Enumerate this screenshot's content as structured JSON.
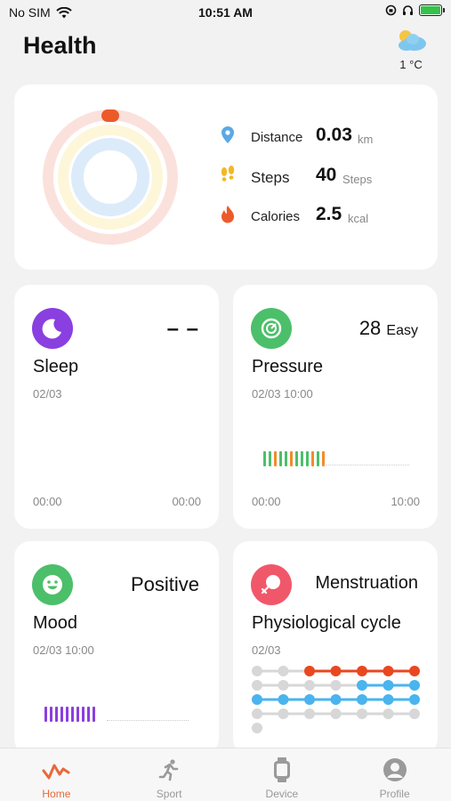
{
  "status_bar": {
    "carrier": "No SIM",
    "time": "10:51 AM"
  },
  "header": {
    "title": "Health",
    "weather_icon": "partly-cloudy-icon",
    "temperature": "1 °C"
  },
  "summary": {
    "metrics": [
      {
        "icon": "location-pin-icon",
        "label": "Distance",
        "value": "0.03",
        "unit": "km",
        "color": "#5aa9e6"
      },
      {
        "icon": "footsteps-icon",
        "label": "Steps",
        "value": "40",
        "unit": "Steps",
        "color": "#f2b824"
      },
      {
        "icon": "flame-icon",
        "label": "Calories",
        "value": "2.5",
        "unit": "kcal",
        "color": "#ec5a2a"
      }
    ],
    "ring_colors": {
      "outer": "#fbe1dc",
      "middle": "#fdf6d9",
      "inner": "#dcebfa",
      "marker": "#ec5a2a"
    }
  },
  "sleep": {
    "title": "Sleep",
    "value": "– –",
    "date": "02/03",
    "axis_start": "00:00",
    "axis_end": "00:00",
    "color": "#8a3fe0"
  },
  "pressure": {
    "title": "Pressure",
    "value": "28",
    "level": "Easy",
    "date": "02/03 10:00",
    "axis_start": "00:00",
    "axis_end": "10:00",
    "color": "#4cbf6a",
    "bar_colors": [
      "#4cbf6a",
      "#4cbf6a",
      "#f28c28",
      "#4cbf6a",
      "#4cbf6a",
      "#f28c28",
      "#4cbf6a",
      "#4cbf6a",
      "#4cbf6a",
      "#f28c28",
      "#4cbf6a",
      "#f28c28"
    ]
  },
  "mood": {
    "title": "Mood",
    "value": "Positive",
    "date": "02/03 10:00",
    "color": "#4cbf6a",
    "bar_color": "#8a3fe0",
    "bar_count": 10
  },
  "cycle": {
    "label": "Menstruation",
    "title": "Physiological cycle",
    "date": "02/03",
    "color": "#f0586a",
    "grey": "#d7d7d7",
    "rows": [
      {
        "color": "#e9471f",
        "active_from": 2
      },
      {
        "color": "#49b4ee",
        "active_from": 4
      },
      {
        "color": "#49b4ee",
        "active_from": 0
      },
      {
        "color": "#d7d7d7",
        "active_from": 7
      },
      {
        "color": "#d7d7d7",
        "active_from": 7,
        "dots": 1
      }
    ]
  },
  "nav": {
    "items": [
      {
        "label": "Home",
        "icon": "home-icon",
        "active": true
      },
      {
        "label": "Sport",
        "icon": "running-icon",
        "active": false
      },
      {
        "label": "Device",
        "icon": "watch-icon",
        "active": false
      },
      {
        "label": "Profile",
        "icon": "profile-icon",
        "active": false
      }
    ],
    "accent": "#e7693a"
  }
}
